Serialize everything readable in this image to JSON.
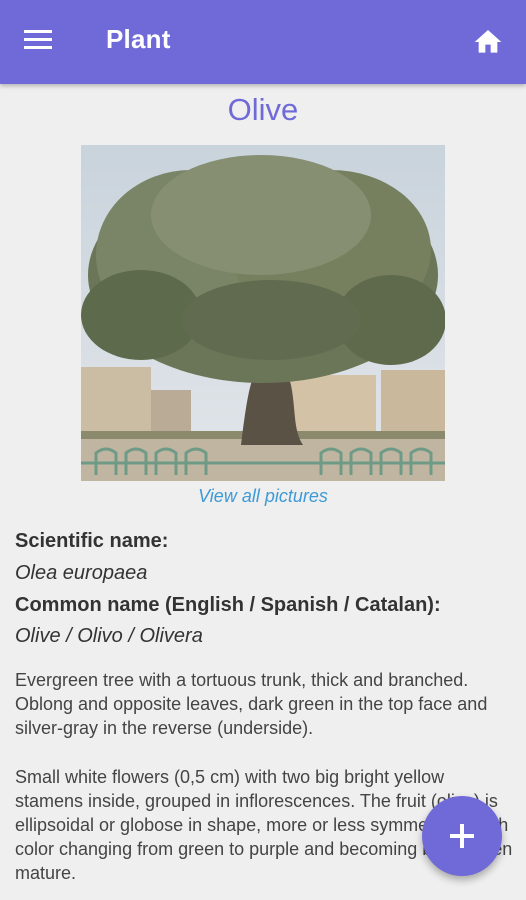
{
  "app_bar": {
    "title": "Plant",
    "menu_icon": "menu-icon",
    "home_icon": "home-icon"
  },
  "plant": {
    "name": "Olive",
    "view_all_label": "View all pictures",
    "scientific_label": "Scientific name:",
    "scientific_value": "Olea europaea",
    "common_label": "Common name (English / Spanish / Catalan):",
    "common_value": "Olive / Olivo / Olivera",
    "description_1": "Evergreen tree with a tortuous trunk, thick and branched. Oblong and opposite leaves, dark green in the top face and silver-gray in the reverse (underside).",
    "description_2": "Small white flowers (0,5 cm) with two big bright yellow stamens inside, grouped in inflorescences. The fruit (olive) is ellipsoidal or globose in shape, more or less symmetrical, with color changing from green to purple and becoming black when mature."
  },
  "fab": {
    "icon": "plus-icon"
  },
  "colors": {
    "primary": "#6f6ad8",
    "link": "#3d9ad6",
    "background": "#efefef"
  }
}
